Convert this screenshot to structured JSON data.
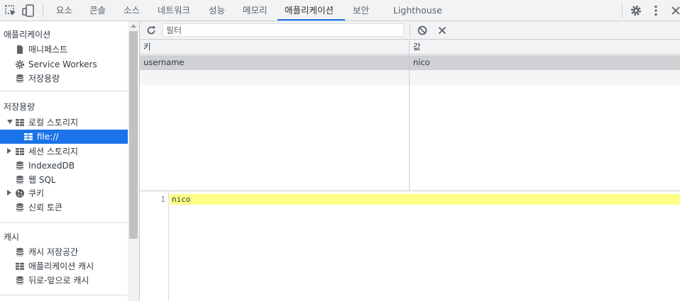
{
  "tabs": [
    "요소",
    "콘솔",
    "소스",
    "네트워크",
    "성능",
    "메모리",
    "애플리케이션",
    "보안",
    "Lighthouse"
  ],
  "active_tab": "애플리케이션",
  "sidebar": {
    "application": {
      "title": "애플리케이션",
      "items": [
        "매니페스트",
        "Service Workers",
        "저장용량"
      ]
    },
    "storage": {
      "title": "저장용량",
      "local_storage": "로컬 스토리지",
      "local_storage_child": "file://",
      "session_storage": "세션 스토리지",
      "indexeddb": "IndexedDB",
      "websql": "웹 SQL",
      "cookies": "쿠키",
      "trust_tokens": "신뢰 토큰"
    },
    "cache": {
      "title": "캐시",
      "items": [
        "캐시 저장공간",
        "애플리케이션 캐시",
        "뒤로-앞으로 캐시"
      ]
    }
  },
  "toolbar": {
    "filter_placeholder": "필터"
  },
  "table": {
    "headers": {
      "key": "키",
      "value": "값"
    },
    "rows": [
      {
        "key": "username",
        "value": "nico"
      }
    ]
  },
  "preview": {
    "line_number": "1",
    "content": "nico"
  },
  "colors": {
    "accent": "#1a73e8",
    "highlight": "#ffff88",
    "selected_row": "#cfd1d4"
  }
}
